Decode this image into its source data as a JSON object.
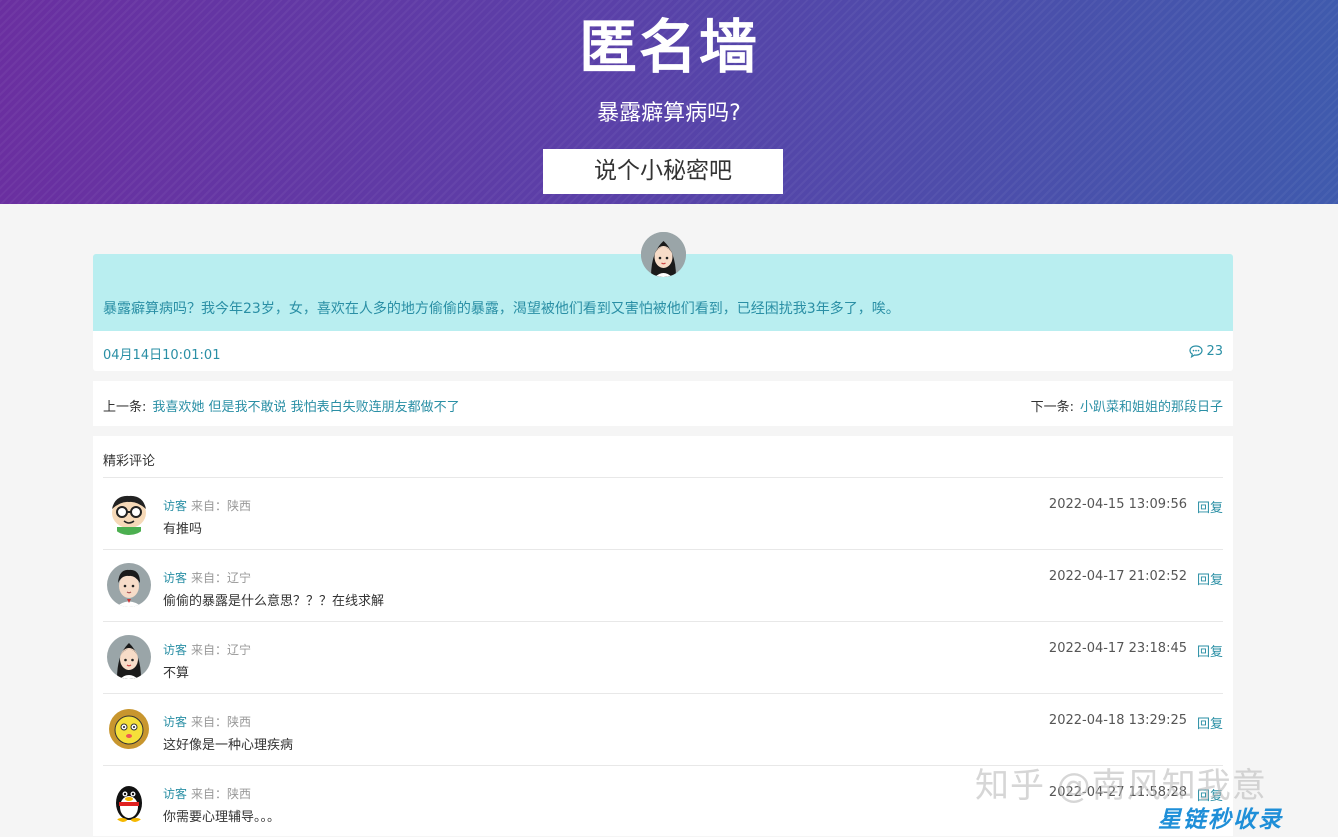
{
  "header": {
    "title": "匿名墙",
    "subtitle": "暴露癖算病吗?",
    "cta_label": "说个小秘密吧"
  },
  "post": {
    "text": "暴露癖算病吗？我今年23岁，女，喜欢在人多的地方偷偷的暴露，渴望被他们看到又害怕被他们看到，已经困扰我3年多了，唉。",
    "date": "04月14日10:01:01",
    "comment_count": "23"
  },
  "nav": {
    "prev_label": "上一条:",
    "prev_title": "我喜欢她 但是我不敢说 我怕表白失败连朋友都做不了",
    "next_label": "下一条:",
    "next_title": "小趴菜和姐姐的那段日子"
  },
  "comments": {
    "title": "精彩评论",
    "items": [
      {
        "user": "访客",
        "from": "来自：陕西",
        "text": "有推吗",
        "time": "2022-04-15 13:09:56",
        "reply": "回复",
        "avatar": "glasses-avatar"
      },
      {
        "user": "访客",
        "from": "来自：辽宁",
        "text": "偷偷的暴露是什么意思？？？在线求解",
        "time": "2022-04-17 21:02:52",
        "reply": "回复",
        "avatar": "boy-avatar"
      },
      {
        "user": "访客",
        "from": "来自：辽宁",
        "text": "不算",
        "time": "2022-04-17 23:18:45",
        "reply": "回复",
        "avatar": "girl-avatar"
      },
      {
        "user": "访客",
        "from": "来自：陕西",
        "text": "这好像是一种心理疾病",
        "time": "2022-04-18 13:29:25",
        "reply": "回复",
        "avatar": "lion-avatar"
      },
      {
        "user": "访客",
        "from": "来自：陕西",
        "text": "你需要心理辅导。。。",
        "time": "2022-04-27 11:58:28",
        "reply": "回复",
        "avatar": "penguin-avatar"
      }
    ]
  },
  "watermark": {
    "line1": "知乎 @南风知我意",
    "line2": "星链秒收录"
  },
  "colors": {
    "accent": "#2a8fa5",
    "post_bg": "#b9eef0",
    "header_gradient_start": "#6a2fa0",
    "header_gradient_end": "#3f5aad"
  }
}
